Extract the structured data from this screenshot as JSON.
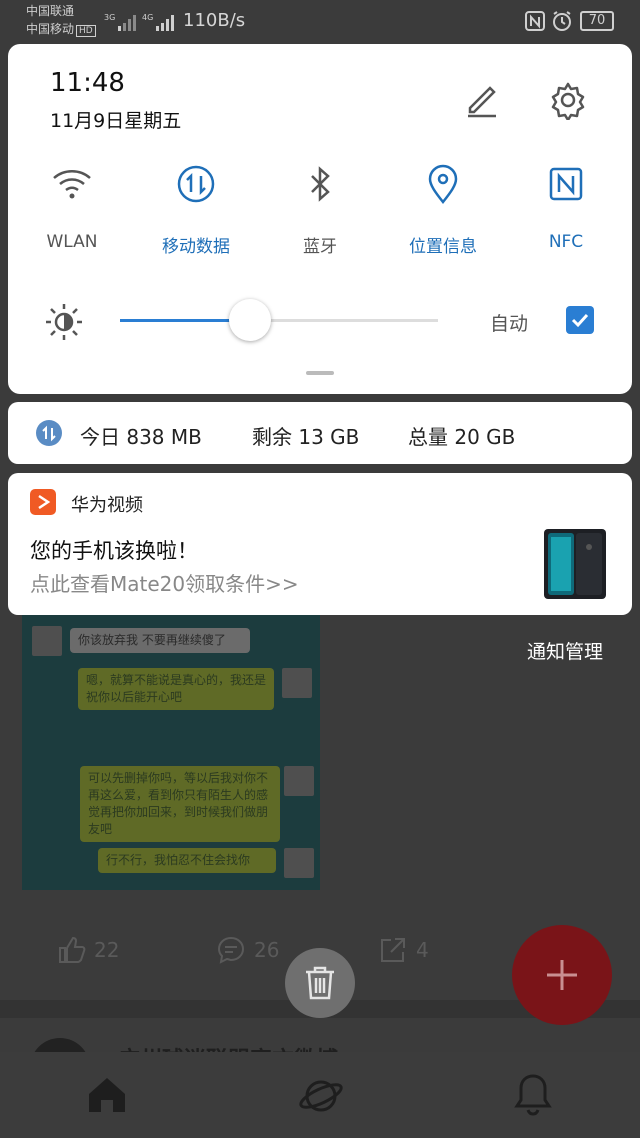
{
  "status_bar": {
    "carrier1": "中国联通",
    "carrier2": "中国移动",
    "hd": "HD",
    "net1": "3G",
    "net2": "4G",
    "speed": "110B/s",
    "battery": "70"
  },
  "quick_settings": {
    "time": "11:48",
    "date": "11月9日星期五",
    "toggles": [
      {
        "label": "WLAN",
        "on": false,
        "icon": "wifi-icon"
      },
      {
        "label": "移动数据",
        "on": true,
        "icon": "mobile-data-icon"
      },
      {
        "label": "蓝牙",
        "on": false,
        "icon": "bluetooth-icon"
      },
      {
        "label": "位置信息",
        "on": true,
        "icon": "location-icon"
      },
      {
        "label": "NFC",
        "on": true,
        "icon": "nfc-icon"
      }
    ],
    "brightness_level": 0.41,
    "auto_label": "自动",
    "auto_checked": true
  },
  "data_usage": {
    "today": "今日 838 MB",
    "remaining": "剩余 13 GB",
    "total": "总量 20 GB"
  },
  "notification": {
    "app_name": "华为视频",
    "title": "您的手机该换啦！",
    "text": "点此查看Mate20领取条件>>"
  },
  "notification_management": "通知管理",
  "background": {
    "bubbles": [
      "你该放弃我 不要再继续傻了",
      "嗯，就算不能说是真心的，我还是祝你以后能开心吧",
      "可以先删掉你吗，等以后我对你不再这么爱，看到你只有陌生人的感觉再把你加回来，到时候我们做朋友吧",
      "行不行，我怕忍不住会找你"
    ],
    "like_count": "22",
    "comment_count": "26",
    "share_count": "4",
    "account_name": "广州球迷联盟官方微博"
  },
  "colors": {
    "accent": "#2a7ed3",
    "fab": "#7a1418",
    "app_icon": "#f05a24"
  }
}
